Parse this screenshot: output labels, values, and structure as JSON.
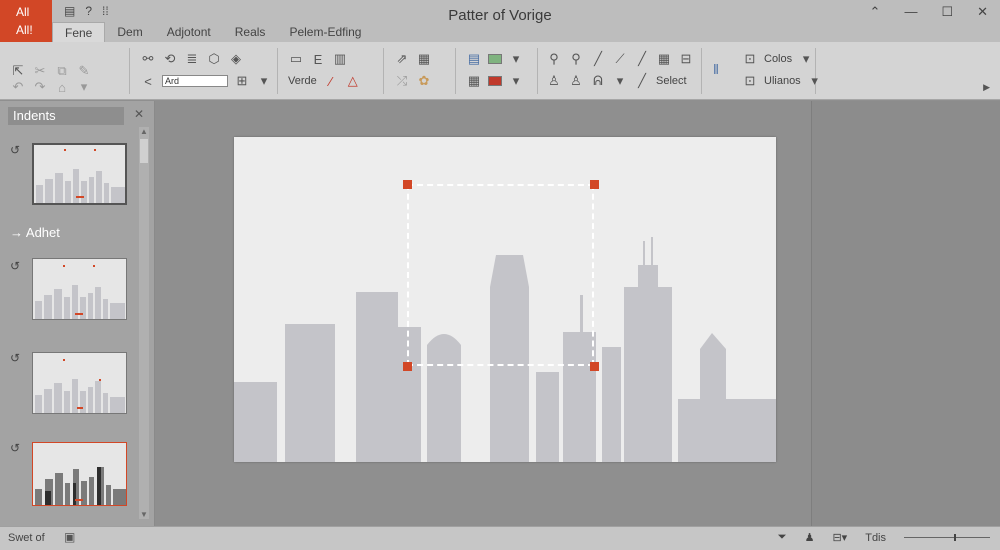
{
  "app": {
    "badge_line1": "All",
    "badge_line2": "All!",
    "title": "Patter of Vorige",
    "accent": "#d24726"
  },
  "quick_access": [
    "▤",
    "?",
    "⁞⁞"
  ],
  "window_controls": [
    "⌃",
    "—",
    "☐",
    "✕"
  ],
  "tabs": [
    "Fene",
    "Dem",
    "Adjotont",
    "Reals",
    "Pelem-Edfing"
  ],
  "ribbon": {
    "text_field_value": "Ard",
    "verde_label": "Verde",
    "select_label": "Select",
    "colors_label": "Colos",
    "ulianos_label": "Ulianos"
  },
  "left_panel": {
    "title": "Indents",
    "section_label": "Adhet",
    "slide_markers": [
      "↺",
      "↺",
      "↺",
      "↺"
    ]
  },
  "status": {
    "left_text": "Swet of",
    "zoom_label": "Tdis"
  },
  "colors": {
    "building": "#c4c4c9",
    "handle": "#d24726",
    "slide_bg": "#ededed"
  }
}
